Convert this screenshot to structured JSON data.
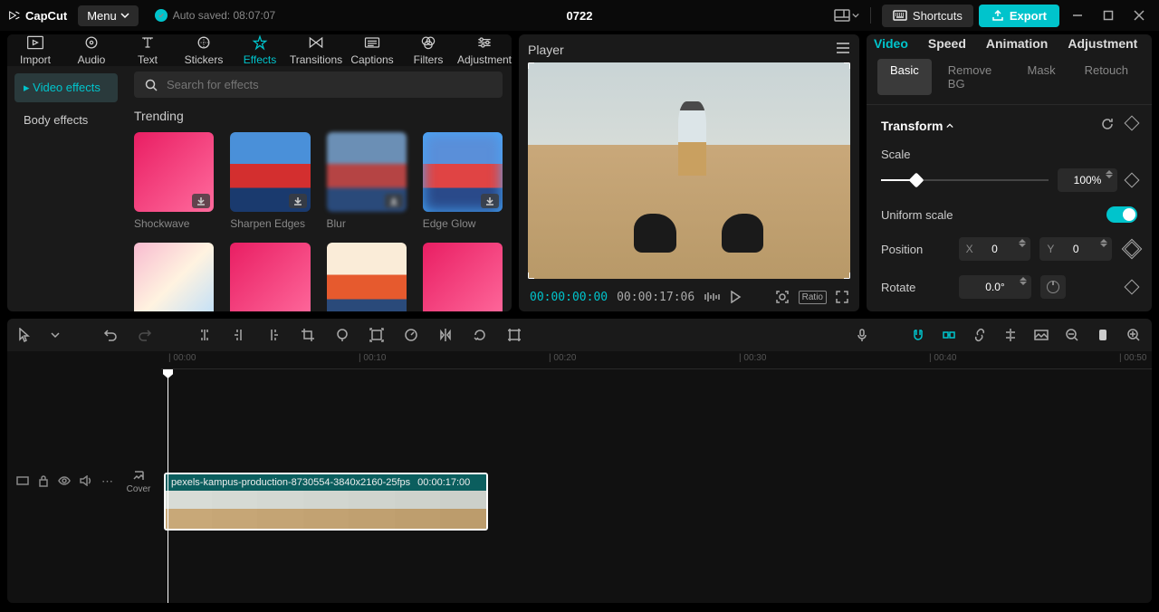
{
  "titlebar": {
    "logo": "CapCut",
    "menu": "Menu",
    "autosave": "Auto saved: 08:07:07",
    "project": "0722",
    "shortcuts": "Shortcuts",
    "export": "Export"
  },
  "media_tabs": {
    "import": "Import",
    "audio": "Audio",
    "text": "Text",
    "stickers": "Stickers",
    "effects": "Effects",
    "transitions": "Transitions",
    "captions": "Captions",
    "filters": "Filters",
    "adjustment": "Adjustment"
  },
  "effect_cats": {
    "video": "Video effects",
    "body": "Body effects"
  },
  "effects_panel": {
    "search_placeholder": "Search for effects",
    "section": "Trending",
    "items": [
      "Shockwave",
      "Sharpen Edges",
      "Blur",
      "Edge Glow"
    ]
  },
  "player": {
    "title": "Player",
    "current": "00:00:00:00",
    "total": "00:00:17:06",
    "ratio": "Ratio"
  },
  "inspector": {
    "tabs": {
      "video": "Video",
      "speed": "Speed",
      "animation": "Animation",
      "adjustment": "Adjustment"
    },
    "subtabs": {
      "basic": "Basic",
      "removebg": "Remove BG",
      "mask": "Mask",
      "retouch": "Retouch"
    },
    "transform": "Transform",
    "scale": "Scale",
    "scale_value": "100%",
    "uniform": "Uniform scale",
    "position": "Position",
    "pos_x": "0",
    "pos_y": "0",
    "rotate": "Rotate",
    "rotate_value": "0.0°"
  },
  "timeline": {
    "ticks": [
      "00:00",
      "00:10",
      "00:20",
      "00:30",
      "00:40",
      "00:50"
    ],
    "cover": "Cover",
    "clip_name": "pexels-kampus-production-8730554-3840x2160-25fps",
    "clip_dur": "00:00:17:00"
  }
}
